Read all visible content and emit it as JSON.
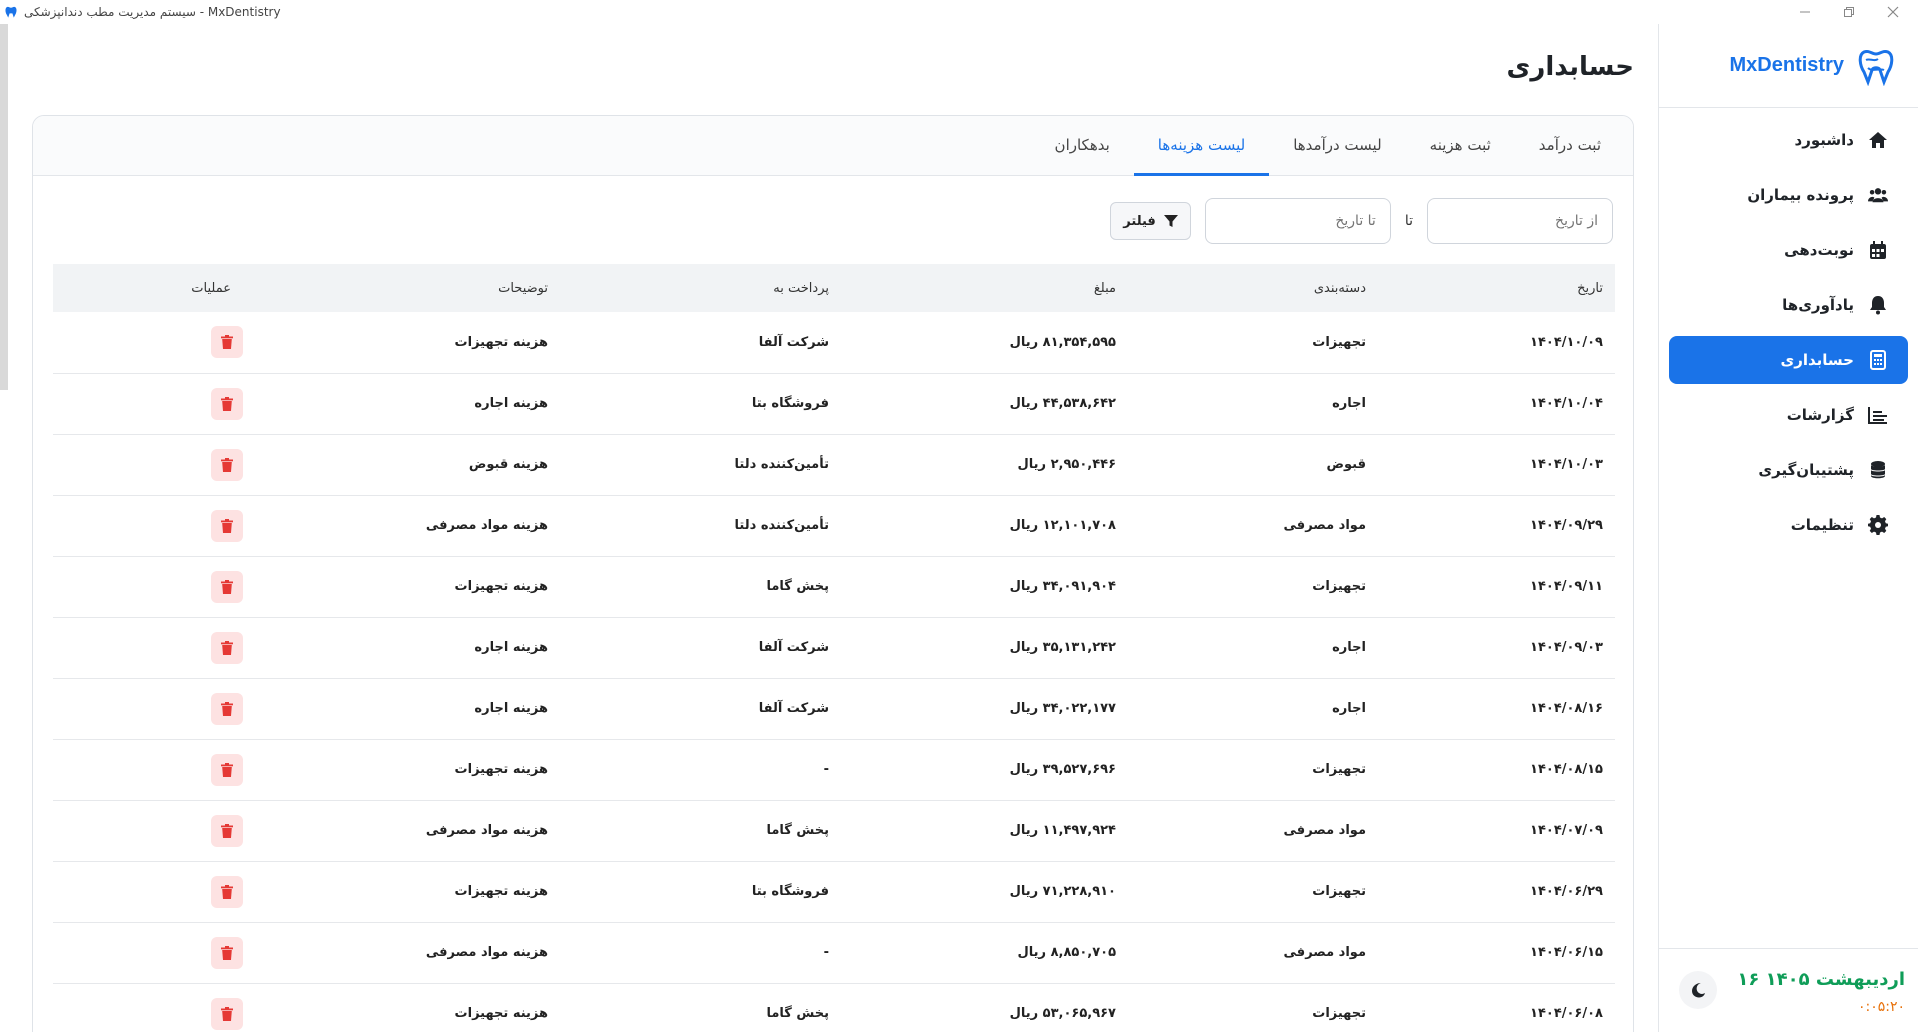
{
  "window": {
    "title": "سیستم مدیریت مطب دندانپزشکی - MxDentistry"
  },
  "brand": {
    "name": "MxDentistry"
  },
  "sidebar": {
    "items": [
      {
        "label": "داشبورد",
        "icon": "home-icon",
        "active": false
      },
      {
        "label": "پرونده بیماران",
        "icon": "users-icon",
        "active": false
      },
      {
        "label": "نوبت‌دهی",
        "icon": "calendar-icon",
        "active": false
      },
      {
        "label": "یادآوری‌ها",
        "icon": "bell-icon",
        "active": false
      },
      {
        "label": "حسابداری",
        "icon": "calculator-icon",
        "active": true
      },
      {
        "label": "گزارشات",
        "icon": "chart-icon",
        "active": false
      },
      {
        "label": "پشتیبان‌گیری",
        "icon": "database-icon",
        "active": false
      },
      {
        "label": "تنظیمات",
        "icon": "gear-icon",
        "active": false
      }
    ],
    "footer": {
      "date": "۱۶ اردیبهشت ۱۴۰۵",
      "time": "۰:۰۵:۲۰"
    }
  },
  "page": {
    "title": "حسابداری"
  },
  "tabs": [
    {
      "label": "ثبت درآمد",
      "active": false
    },
    {
      "label": "ثبت هزینه",
      "active": false
    },
    {
      "label": "لیست درآمدها",
      "active": false
    },
    {
      "label": "لیست هزینه‌ها",
      "active": true
    },
    {
      "label": "بدهکاران",
      "active": false
    }
  ],
  "filters": {
    "from_placeholder": "از تاریخ",
    "to_label": "تا",
    "to_placeholder": "تا تاریخ",
    "filter_button": "فیلتر"
  },
  "table": {
    "headers": {
      "date": "تاریخ",
      "category": "دسته‌بندی",
      "amount": "مبلغ",
      "payee": "پرداخت به",
      "description": "توضیحات",
      "operations": "عملیات"
    },
    "rows": [
      {
        "date": "۱۴۰۴/۱۰/۰۹",
        "category": "تجهیزات",
        "amount": "۸۱,۳۵۴,۵۹۵ ریال",
        "payee": "شرکت آلفا",
        "description": "هزینه تجهیزات"
      },
      {
        "date": "۱۴۰۴/۱۰/۰۴",
        "category": "اجاره",
        "amount": "۴۴,۵۳۸,۶۴۲ ریال",
        "payee": "فروشگاه بتا",
        "description": "هزینه اجاره"
      },
      {
        "date": "۱۴۰۴/۱۰/۰۳",
        "category": "قبوض",
        "amount": "۲,۹۵۰,۴۴۶ ریال",
        "payee": "تأمین‌کننده دلتا",
        "description": "هزینه قبوض"
      },
      {
        "date": "۱۴۰۴/۰۹/۲۹",
        "category": "مواد مصرفی",
        "amount": "۱۲,۱۰۱,۷۰۸ ریال",
        "payee": "تأمین‌کننده دلتا",
        "description": "هزینه مواد مصرفی"
      },
      {
        "date": "۱۴۰۴/۰۹/۱۱",
        "category": "تجهیزات",
        "amount": "۳۴,۰۹۱,۹۰۴ ریال",
        "payee": "پخش گاما",
        "description": "هزینه تجهیزات"
      },
      {
        "date": "۱۴۰۴/۰۹/۰۳",
        "category": "اجاره",
        "amount": "۳۵,۱۳۱,۲۴۲ ریال",
        "payee": "شرکت آلفا",
        "description": "هزینه اجاره"
      },
      {
        "date": "۱۴۰۴/۰۸/۱۶",
        "category": "اجاره",
        "amount": "۳۴,۰۲۲,۱۷۷ ریال",
        "payee": "شرکت آلفا",
        "description": "هزینه اجاره"
      },
      {
        "date": "۱۴۰۴/۰۸/۱۵",
        "category": "تجهیزات",
        "amount": "۳۹,۵۲۷,۶۹۶ ریال",
        "payee": "-",
        "description": "هزینه تجهیزات"
      },
      {
        "date": "۱۴۰۴/۰۷/۰۹",
        "category": "مواد مصرفی",
        "amount": "۱۱,۴۹۷,۹۲۴ ریال",
        "payee": "پخش گاما",
        "description": "هزینه مواد مصرفی"
      },
      {
        "date": "۱۴۰۴/۰۶/۲۹",
        "category": "تجهیزات",
        "amount": "۷۱,۲۲۸,۹۱۰ ریال",
        "payee": "فروشگاه بتا",
        "description": "هزینه تجهیزات"
      },
      {
        "date": "۱۴۰۴/۰۶/۱۵",
        "category": "مواد مصرفی",
        "amount": "۸,۸۵۰,۷۰۵ ریال",
        "payee": "-",
        "description": "هزینه مواد مصرفی"
      },
      {
        "date": "۱۴۰۴/۰۶/۰۸",
        "category": "تجهیزات",
        "amount": "۵۳,۰۶۵,۹۶۷ ریال",
        "payee": "پخش گاما",
        "description": "هزینه تجهیزات"
      }
    ]
  },
  "colors": {
    "accent": "#1a73e8",
    "danger": "#e53935",
    "danger_bg": "#fde2e2",
    "date_green": "#0f9d58",
    "time_orange": "#e8710a"
  }
}
